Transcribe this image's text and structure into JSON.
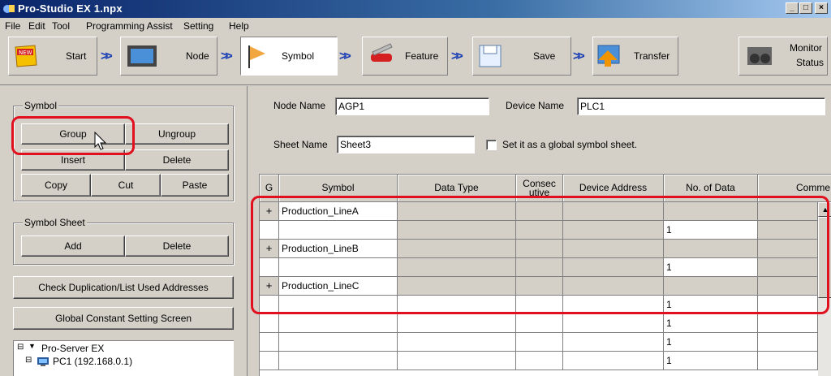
{
  "window": {
    "title": "Pro-Studio EX   1.npx"
  },
  "menu": [
    "File",
    "Edit",
    "Tool",
    "Programming Assist",
    "Setting",
    "Help"
  ],
  "toolbar": {
    "start": "Start",
    "node": "Node",
    "symbol": "Symbol",
    "feature": "Feature",
    "save": "Save",
    "transfer": "Transfer",
    "monitor_line1": "Monitor",
    "monitor_line2": "Status",
    "arrow": ">>"
  },
  "left": {
    "symbol_group": "Symbol",
    "group": "Group",
    "ungroup": "Ungroup",
    "insert": "Insert",
    "delete": "Delete",
    "copy": "Copy",
    "cut": "Cut",
    "paste": "Paste",
    "sheet_group": "Symbol Sheet",
    "add": "Add",
    "sheet_delete": "Delete",
    "check_dup": "Check Duplication/List Used Addresses",
    "global_const": "Global Constant Setting Screen",
    "tree_root": "Pro-Server EX",
    "tree_pc": "PC1 (192.168.0.1)"
  },
  "form": {
    "node_label": "Node Name",
    "node_value": "AGP1",
    "device_label": "Device Name",
    "device_value": "PLC1",
    "sheet_label": "Sheet Name",
    "sheet_value": "Sheet3",
    "global_check_label": "Set it as a global symbol sheet."
  },
  "grid": {
    "headers": [
      "G",
      "Symbol",
      "Data Type",
      "Consec utive",
      "Device Address",
      "No. of Data",
      "Comme"
    ],
    "rows": [
      {
        "g": "+",
        "symbol": "Production_LineA",
        "count": ""
      },
      {
        "g": "",
        "symbol": "",
        "count": "1"
      },
      {
        "g": "+",
        "symbol": "Production_LineB",
        "count": ""
      },
      {
        "g": "",
        "symbol": "",
        "count": "1"
      },
      {
        "g": "+",
        "symbol": "Production_LineC",
        "count": ""
      },
      {
        "g": "",
        "symbol": "",
        "count": "1"
      },
      {
        "g": "",
        "symbol": "",
        "count": "1"
      },
      {
        "g": "",
        "symbol": "",
        "count": "1"
      },
      {
        "g": "",
        "symbol": "",
        "count": "1"
      }
    ]
  },
  "colors": {
    "highlight": "#e0101e",
    "titlebar": "#0a246a",
    "arrow": "#1a3fb4"
  }
}
